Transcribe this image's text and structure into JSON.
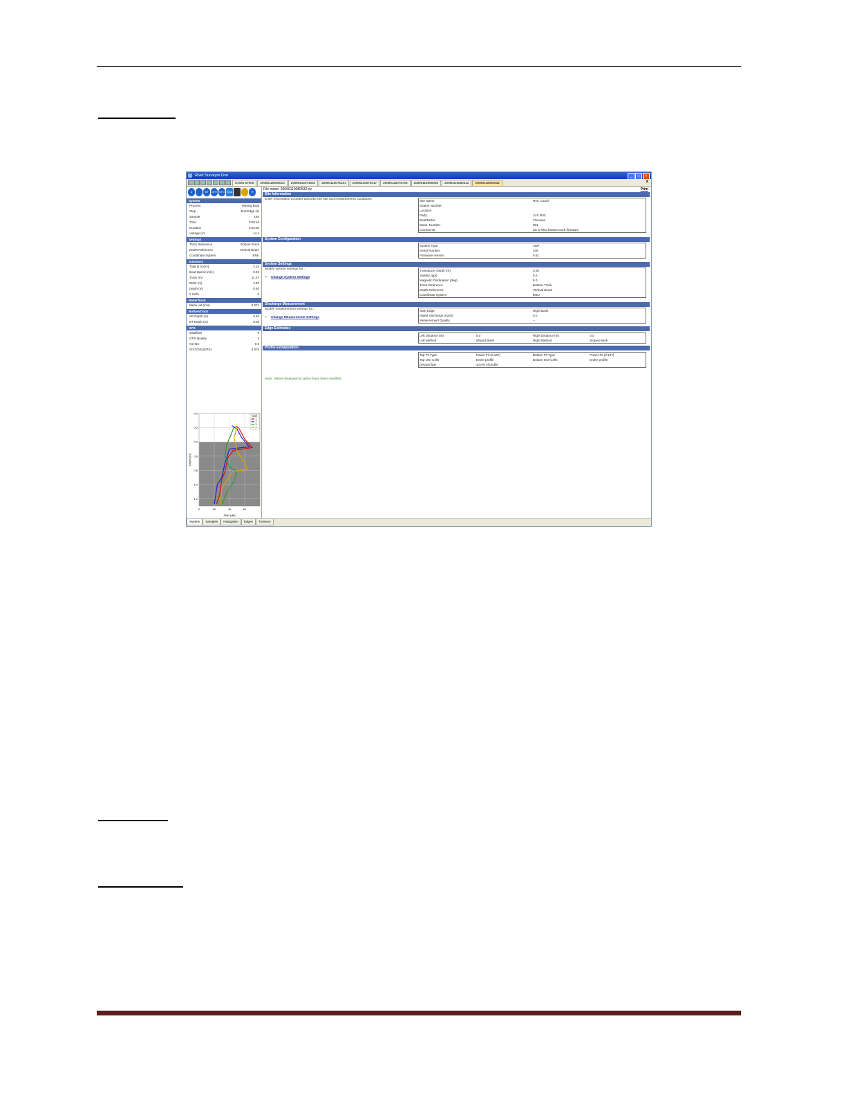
{
  "window": {
    "title": "River Surveyor Live",
    "file_tabs": [
      "COM1 57600",
      "20090116000015",
      "20090116074644",
      "20090116075131",
      "20090116075417",
      "20090116075736",
      "20090116080005",
      "20090116080312",
      "20090119080532"
    ],
    "close_x": "x"
  },
  "left_panel": {
    "iconbar": [
      "BT",
      "BTV",
      "VTG",
      "GGA",
      "VTG"
    ],
    "sections": [
      {
        "title": "System",
        "items": [
          [
            "Process",
            "Moving Boat"
          ],
          [
            "Step",
            "End Edge (1)"
          ],
          [
            "Sample",
            "193"
          ],
          [
            "Time",
            "8:09:16"
          ],
          [
            "Duration",
            "0:03:30"
          ],
          [
            "Voltage (V)",
            "14.4"
          ]
        ]
      },
      {
        "title": "Settings",
        "items": [
          [
            "Track Reference",
            "Bottom-Track"
          ],
          [
            "Depth Reference",
            "Vertical Beam"
          ],
          [
            "Coordinate System",
            "ENU"
          ]
        ]
      },
      {
        "title": "Summary",
        "items": [
          [
            "Total Q (m3/s)",
            "2.24"
          ],
          [
            "Boat Speed (m/s)",
            "0.02"
          ],
          [
            "Track (m)",
            "11.57"
          ],
          [
            "DMG (m)",
            "4.65"
          ],
          [
            "Depth (m)",
            "0.40"
          ],
          [
            "# Cells",
            "6"
          ]
        ]
      },
      {
        "title": "WaterTrack",
        "items": [
          [
            "Mean vel (m/s)",
            "0.071"
          ]
        ]
      },
      {
        "title": "BottomTrack",
        "items": [
          [
            "VB Depth (m)",
            "0.40"
          ],
          [
            "BT Depth (m)",
            "0.39"
          ]
        ]
      },
      {
        "title": "GPS",
        "items": [
          [
            "Satellites",
            "9"
          ],
          [
            "GPS Quality",
            "4"
          ],
          [
            "GC-BC",
            "0.0"
          ],
          [
            "DIST/DIG(GPS)",
            "0.975"
          ]
        ]
      }
    ],
    "bottom_tabs": [
      "System",
      "Samples",
      "Navigation",
      "Edges",
      "Transect"
    ]
  },
  "chart_data": {
    "type": "line",
    "xlabel": "SNR (dB)",
    "ylabel": "Depth (m)",
    "xlim": [
      0,
      80
    ],
    "ylim": [
      1.3,
      0.0
    ],
    "x_ticks": [
      "0",
      "20",
      "40",
      "60"
    ],
    "y_ticks": [
      "0.0",
      "0.2",
      "0.4",
      "0.6",
      "0.8",
      "1.0",
      "1.2"
    ],
    "legend_title": "SNR",
    "series": [
      {
        "name": "1",
        "color": "#d01010",
        "values": [
          [
            48,
            0.18
          ],
          [
            52,
            0.2
          ],
          [
            60,
            0.36
          ],
          [
            70,
            0.48
          ],
          [
            45,
            0.52
          ],
          [
            38,
            0.62
          ],
          [
            34,
            0.82
          ],
          [
            30,
            0.92
          ],
          [
            27,
            1.15
          ],
          [
            23,
            1.27
          ]
        ]
      },
      {
        "name": "2",
        "color": "#2020c8",
        "values": [
          [
            43,
            0.17
          ],
          [
            50,
            0.22
          ],
          [
            56,
            0.34
          ],
          [
            66,
            0.47
          ],
          [
            40,
            0.5
          ],
          [
            34,
            0.7
          ],
          [
            30,
            0.9
          ],
          [
            24,
            1.0
          ],
          [
            20,
            1.27
          ]
        ]
      },
      {
        "name": "3",
        "color": "#2e9a2e",
        "values": [
          [
            46,
            0.19
          ],
          [
            42,
            0.3
          ],
          [
            36,
            0.45
          ],
          [
            34,
            0.6
          ],
          [
            40,
            0.75
          ],
          [
            50,
            0.82
          ],
          [
            46,
            0.95
          ],
          [
            36,
            1.12
          ],
          [
            30,
            1.28
          ]
        ]
      },
      {
        "name": "4",
        "color": "#e0a000",
        "values": [
          [
            50,
            0.2
          ],
          [
            46,
            0.34
          ],
          [
            50,
            0.52
          ],
          [
            64,
            0.78
          ],
          [
            44,
            0.82
          ],
          [
            36,
            0.95
          ],
          [
            30,
            1.05
          ],
          [
            28,
            1.29
          ]
        ]
      }
    ]
  },
  "right_panel": {
    "filename": "File name: 20090119080532.riv",
    "print": "Print",
    "note": "Note: Values displayed in green have been modified.",
    "sections": {
      "site": {
        "title": "Site Information",
        "prompt": "Enter information to better describe the site and measurement conditions",
        "rows": [
          [
            "Site Name",
            "Res. Canal"
          ],
          [
            "Station Number",
            ""
          ],
          [
            "Location",
            ""
          ],
          [
            "Party",
            "JVS MJC"
          ],
          [
            "Boat/Motor",
            "Trimaran"
          ],
          [
            "Meas. Number",
            "001"
          ],
          [
            "Comments",
            "S5 w New bottom track firmware"
          ]
        ]
      },
      "config": {
        "title": "System Configuration",
        "rows": [
          [
            "System Type",
            "ADP"
          ],
          [
            "Serial Number",
            "108"
          ],
          [
            "Firmware Version",
            "0.61"
          ]
        ]
      },
      "settings": {
        "title": "System Settings",
        "prompt": "Modify system settings for...",
        "link": "Change System Settings",
        "rows": [
          [
            "Transducer Depth (m)",
            "0.06"
          ],
          [
            "Salinity (ppt)",
            "0.0"
          ],
          [
            "Magnetic Declination (deg)",
            "5.0"
          ],
          [
            "Track Reference",
            "Bottom-Track"
          ],
          [
            "Depth Reference",
            "Vertical Beam"
          ],
          [
            "Coordinate System",
            "ENU"
          ]
        ]
      },
      "discharge": {
        "title": "Discharge Measurement",
        "prompt": "Modify measurement settings for...",
        "link": "Change Measurement Settings",
        "rows": [
          [
            "Start Edge",
            "Right Bank"
          ],
          [
            "Rated Discharge (m3/s)",
            "0.0"
          ],
          [
            "Measurement Quality",
            "--"
          ]
        ]
      },
      "edge": {
        "title": "Edge Estimates",
        "rows": [
          [
            "Left Distance (m)",
            "0.0",
            "Right Distance (m)",
            "0.0"
          ],
          [
            "Left Method",
            "Sloped Bank",
            "Right Method",
            "Sloped Bank"
          ]
        ]
      },
      "profile": {
        "title": "Profile Extrapolation",
        "rows": [
          [
            "Top Fit Type",
            "Power Fit (0.167)",
            "Bottom Fit Type",
            "Power Fit (0.167)"
          ],
          [
            "Top Use Cells",
            "Entire profile",
            "Bottom Use Cells",
            "Entire profile"
          ],
          [
            "Discard last",
            "10.0% of profile",
            "",
            ""
          ]
        ]
      }
    }
  }
}
